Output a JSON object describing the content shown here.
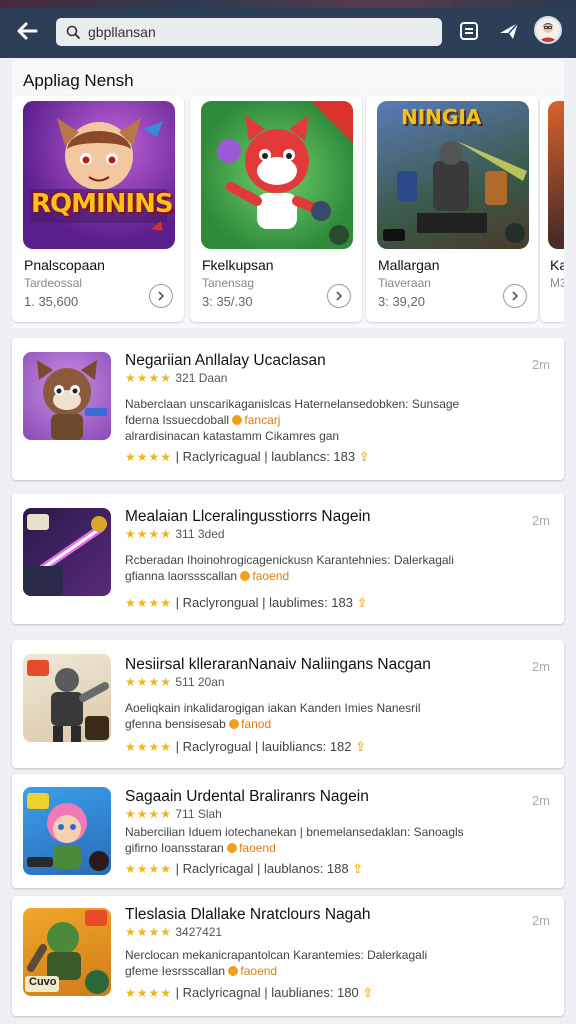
{
  "topbar": {
    "search_value": "gbpllansan",
    "search_placeholder": "gbpllansan"
  },
  "featured": {
    "title": "Appliag Nensh",
    "cards": [
      {
        "name": "Pnalscopaan",
        "dev": "Tardeossal",
        "meta": "1. 35,600",
        "art_text": "RQMININS"
      },
      {
        "name": "Fkelkupsan",
        "dev": "Tanensag",
        "meta": "3: 35/.30",
        "art_text": ""
      },
      {
        "name": "Mallargan",
        "dev": "Tiaveraan",
        "meta": "3: 39,20",
        "art_text": "NINGIA"
      },
      {
        "name": "Ka",
        "dev": "M3",
        "meta": "",
        "art_text": ""
      }
    ]
  },
  "list": [
    {
      "title": "Negariian Anllalay Ucaclasan",
      "time": "2m",
      "rating": "321 Daan",
      "desc1": "Naberclaan unscarikaganislcas Haternelansedobken: Sunsage",
      "desc2a": "fderna Issuecdoball",
      "tag": "fancarj",
      "desc3": "alrardisinacan katastamm Cikamres gan",
      "stats": "| Raclyricagual | laublancs:  183"
    },
    {
      "title": "Mealaian Llceralingusstiorrs Nagein",
      "time": "2m",
      "rating": "311 3ded",
      "desc1": "Rcberadan Ihoinohrogicagenickusn Karantehnies: Dalerkagali",
      "desc2a": "gfianna laorssscallan",
      "tag": "faoend",
      "desc3": "",
      "stats": "| Raclyrongual | laublimes:  183"
    },
    {
      "title": "Nesiirsal  klleraranNanaiv Naliingans Nacgan",
      "time": "2m",
      "rating": "511 20an",
      "desc1": "Aoeliqkain inkalidarogigan iakan Kanden Imies Nanesril",
      "desc2a": "gfenna bensisesab",
      "tag": "fanod",
      "desc3": "",
      "stats": "| Raclyrogual | lauibliancs:  182"
    },
    {
      "title": "Sagaain Urdental Braliranrs Nagein",
      "time": "2m",
      "rating": "711 Slah",
      "desc1": "Nabercilian Iduem iotechanekan | bnemelansedaklan: Sanoagls",
      "desc2a": "gifirno Ioansstaran",
      "tag": "faoend",
      "desc3": "",
      "stats": "| Raclyricagal | laublanos:  188"
    },
    {
      "title": "Tleslasia Dlallake Nratclours Nagah",
      "time": "2m",
      "rating": "3427421",
      "desc1": "Nerclocan mekanicrapantolcan Karantemies: Dalerkagali",
      "desc2a": "gfeme Iesrsscallan",
      "tag": "faoend",
      "desc3": "",
      "stats": "| Raclyricagnal | laublianes:  180"
    }
  ]
}
